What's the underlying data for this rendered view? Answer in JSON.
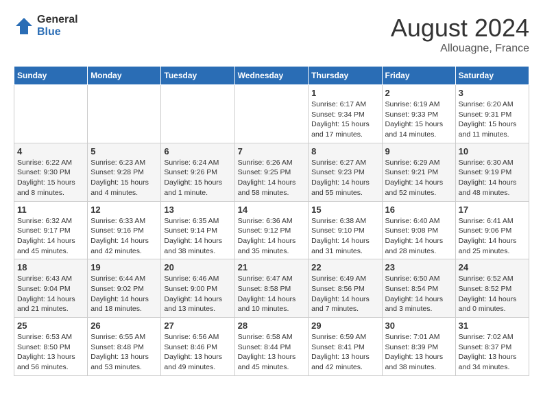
{
  "logo": {
    "general": "General",
    "blue": "Blue"
  },
  "title": {
    "month_year": "August 2024",
    "location": "Allouagne, France"
  },
  "days_of_week": [
    "Sunday",
    "Monday",
    "Tuesday",
    "Wednesday",
    "Thursday",
    "Friday",
    "Saturday"
  ],
  "weeks": [
    [
      {
        "day": "",
        "info": ""
      },
      {
        "day": "",
        "info": ""
      },
      {
        "day": "",
        "info": ""
      },
      {
        "day": "",
        "info": ""
      },
      {
        "day": "1",
        "info": "Sunrise: 6:17 AM\nSunset: 9:34 PM\nDaylight: 15 hours and 17 minutes."
      },
      {
        "day": "2",
        "info": "Sunrise: 6:19 AM\nSunset: 9:33 PM\nDaylight: 15 hours and 14 minutes."
      },
      {
        "day": "3",
        "info": "Sunrise: 6:20 AM\nSunset: 9:31 PM\nDaylight: 15 hours and 11 minutes."
      }
    ],
    [
      {
        "day": "4",
        "info": "Sunrise: 6:22 AM\nSunset: 9:30 PM\nDaylight: 15 hours and 8 minutes."
      },
      {
        "day": "5",
        "info": "Sunrise: 6:23 AM\nSunset: 9:28 PM\nDaylight: 15 hours and 4 minutes."
      },
      {
        "day": "6",
        "info": "Sunrise: 6:24 AM\nSunset: 9:26 PM\nDaylight: 15 hours and 1 minute."
      },
      {
        "day": "7",
        "info": "Sunrise: 6:26 AM\nSunset: 9:25 PM\nDaylight: 14 hours and 58 minutes."
      },
      {
        "day": "8",
        "info": "Sunrise: 6:27 AM\nSunset: 9:23 PM\nDaylight: 14 hours and 55 minutes."
      },
      {
        "day": "9",
        "info": "Sunrise: 6:29 AM\nSunset: 9:21 PM\nDaylight: 14 hours and 52 minutes."
      },
      {
        "day": "10",
        "info": "Sunrise: 6:30 AM\nSunset: 9:19 PM\nDaylight: 14 hours and 48 minutes."
      }
    ],
    [
      {
        "day": "11",
        "info": "Sunrise: 6:32 AM\nSunset: 9:17 PM\nDaylight: 14 hours and 45 minutes."
      },
      {
        "day": "12",
        "info": "Sunrise: 6:33 AM\nSunset: 9:16 PM\nDaylight: 14 hours and 42 minutes."
      },
      {
        "day": "13",
        "info": "Sunrise: 6:35 AM\nSunset: 9:14 PM\nDaylight: 14 hours and 38 minutes."
      },
      {
        "day": "14",
        "info": "Sunrise: 6:36 AM\nSunset: 9:12 PM\nDaylight: 14 hours and 35 minutes."
      },
      {
        "day": "15",
        "info": "Sunrise: 6:38 AM\nSunset: 9:10 PM\nDaylight: 14 hours and 31 minutes."
      },
      {
        "day": "16",
        "info": "Sunrise: 6:40 AM\nSunset: 9:08 PM\nDaylight: 14 hours and 28 minutes."
      },
      {
        "day": "17",
        "info": "Sunrise: 6:41 AM\nSunset: 9:06 PM\nDaylight: 14 hours and 25 minutes."
      }
    ],
    [
      {
        "day": "18",
        "info": "Sunrise: 6:43 AM\nSunset: 9:04 PM\nDaylight: 14 hours and 21 minutes."
      },
      {
        "day": "19",
        "info": "Sunrise: 6:44 AM\nSunset: 9:02 PM\nDaylight: 14 hours and 18 minutes."
      },
      {
        "day": "20",
        "info": "Sunrise: 6:46 AM\nSunset: 9:00 PM\nDaylight: 14 hours and 13 minutes."
      },
      {
        "day": "21",
        "info": "Sunrise: 6:47 AM\nSunset: 8:58 PM\nDaylight: 14 hours and 10 minutes."
      },
      {
        "day": "22",
        "info": "Sunrise: 6:49 AM\nSunset: 8:56 PM\nDaylight: 14 hours and 7 minutes."
      },
      {
        "day": "23",
        "info": "Sunrise: 6:50 AM\nSunset: 8:54 PM\nDaylight: 14 hours and 3 minutes."
      },
      {
        "day": "24",
        "info": "Sunrise: 6:52 AM\nSunset: 8:52 PM\nDaylight: 14 hours and 0 minutes."
      }
    ],
    [
      {
        "day": "25",
        "info": "Sunrise: 6:53 AM\nSunset: 8:50 PM\nDaylight: 13 hours and 56 minutes."
      },
      {
        "day": "26",
        "info": "Sunrise: 6:55 AM\nSunset: 8:48 PM\nDaylight: 13 hours and 53 minutes."
      },
      {
        "day": "27",
        "info": "Sunrise: 6:56 AM\nSunset: 8:46 PM\nDaylight: 13 hours and 49 minutes."
      },
      {
        "day": "28",
        "info": "Sunrise: 6:58 AM\nSunset: 8:44 PM\nDaylight: 13 hours and 45 minutes."
      },
      {
        "day": "29",
        "info": "Sunrise: 6:59 AM\nSunset: 8:41 PM\nDaylight: 13 hours and 42 minutes."
      },
      {
        "day": "30",
        "info": "Sunrise: 7:01 AM\nSunset: 8:39 PM\nDaylight: 13 hours and 38 minutes."
      },
      {
        "day": "31",
        "info": "Sunrise: 7:02 AM\nSunset: 8:37 PM\nDaylight: 13 hours and 34 minutes."
      }
    ]
  ]
}
